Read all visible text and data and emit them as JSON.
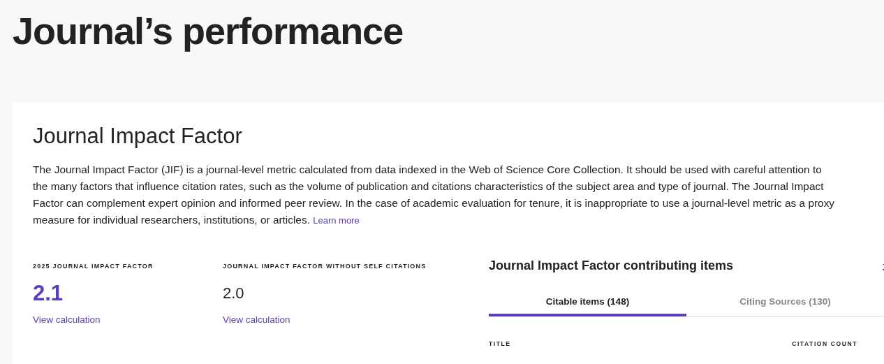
{
  "page_title": "Journal’s performance",
  "card": {
    "title": "Journal Impact Factor",
    "description": "The Journal Impact Factor (JIF) is a journal-level metric calculated from data indexed in the Web of Science Core Collection. It should be used with careful attention to the many factors that influence citation rates, such as the volume of publication and citations characteristics of the subject area and type of journal. The Journal Impact Factor can complement expert opinion and informed peer review. In the case of academic evaluation for tenure, it is inappropriate to use a journal-level metric as a proxy measure for individual researchers, institutions, or articles.",
    "learn_more": "Learn more",
    "metrics": [
      {
        "label": "2025 JOURNAL IMPACT FACTOR",
        "value": "2.1",
        "highlight": true,
        "link": "View calculation"
      },
      {
        "label": "JOURNAL IMPACT FACTOR WITHOUT SELF CITATIONS",
        "value": "2.0",
        "highlight": false,
        "link": "View calculation"
      }
    ],
    "contributing": {
      "title": "Journal Impact Factor contributing items",
      "tabs": [
        {
          "label": "Citable items (148)",
          "selected": true
        },
        {
          "label": "Citing Sources (130)",
          "selected": false
        }
      ],
      "columns": [
        "TITLE",
        "CITATION COUNT"
      ]
    }
  }
}
